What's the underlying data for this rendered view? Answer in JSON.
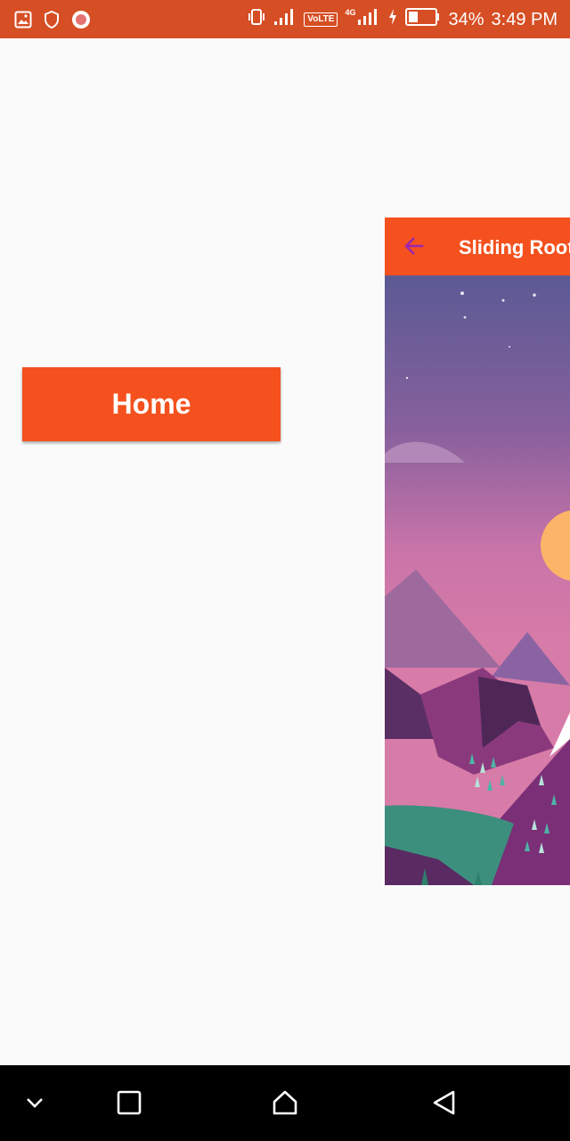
{
  "status_bar": {
    "left_icons": [
      "image-icon",
      "shield-icon",
      "record-icon"
    ],
    "right_icons": [
      "vibrate-icon",
      "signal-icon",
      "volte-icon",
      "signal-4g-icon",
      "charging-icon",
      "battery-icon"
    ],
    "volte_label": "VoLTE",
    "network_label": "4G",
    "battery_percent": "34%",
    "time": "3:49 PM",
    "battery_level": 0.34,
    "background_color": "#d64e24"
  },
  "menu": {
    "home_label": "Home",
    "accent_color": "#f4511e"
  },
  "content": {
    "toolbar_title": "Sliding Root",
    "back_icon": "arrow-back-icon",
    "toolbar_color": "#f4511e",
    "back_icon_color": "#9c27b0",
    "illustration": "mountain-landscape-illustration"
  },
  "nav_bar": {
    "buttons": [
      "chevron-down-icon",
      "recent-apps-icon",
      "home-icon",
      "back-icon"
    ]
  }
}
